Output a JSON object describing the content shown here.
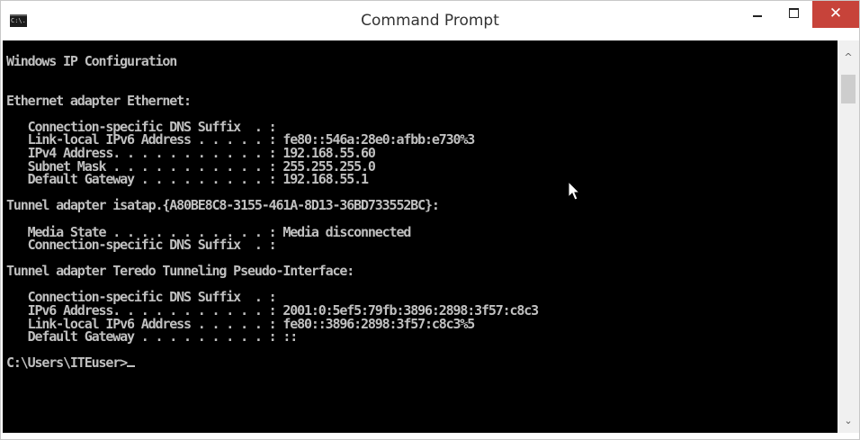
{
  "window": {
    "title": "Command Prompt",
    "icon": "cmd-icon",
    "icon_text": "C:\\.",
    "controls": {
      "minimize": "minimize-icon",
      "maximize": "maximize-icon",
      "close": "close-icon",
      "close_glyph": "✕"
    }
  },
  "console": {
    "lines": [
      "Windows IP Configuration",
      "",
      "",
      "Ethernet adapter Ethernet:",
      "",
      "   Connection-specific DNS Suffix  . :",
      "   Link-local IPv6 Address . . . . . : fe80::546a:28e0:afbb:e730%3",
      "   IPv4 Address. . . . . . . . . . . : 192.168.55.60",
      "   Subnet Mask . . . . . . . . . . . : 255.255.255.0",
      "   Default Gateway . . . . . . . . . : 192.168.55.1",
      "",
      "Tunnel adapter isatap.{A80BE8C8-3155-461A-8D13-36BD733552BC}:",
      "",
      "   Media State . . . . . . . . . . . : Media disconnected",
      "   Connection-specific DNS Suffix  . :",
      "",
      "Tunnel adapter Teredo Tunneling Pseudo-Interface:",
      "",
      "   Connection-specific DNS Suffix  . :",
      "   IPv6 Address. . . . . . . . . . . : 2001:0:5ef5:79fb:3896:2898:3f57:c8c3",
      "   Link-local IPv6 Address . . . . . : fe80::3896:2898:3f57:c8c3%5",
      "   Default Gateway . . . . . . . . . : ::",
      ""
    ],
    "prompt": "C:\\Users\\ITEuser>",
    "text_color": "#c0c0c0",
    "background": "#000000"
  },
  "scrollbar": {
    "up_icon": "arrow-up-icon",
    "down_icon": "arrow-down-icon",
    "up_glyph": "^",
    "down_glyph": "⌄"
  }
}
